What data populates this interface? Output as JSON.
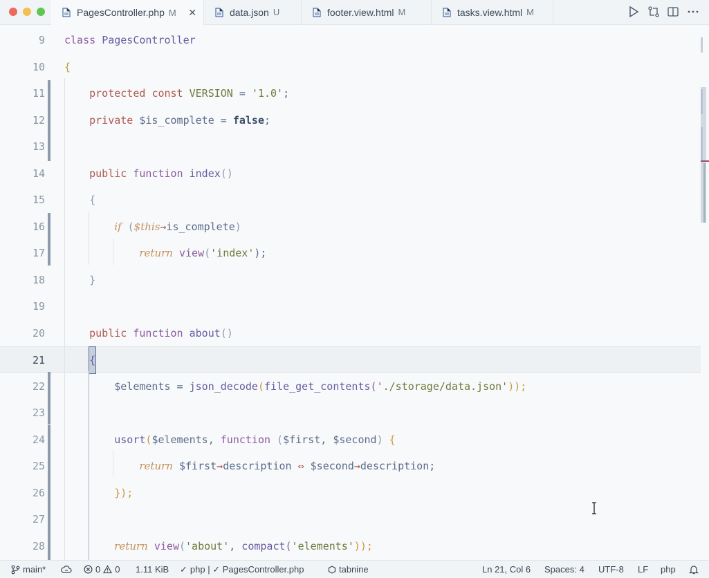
{
  "tabs": [
    {
      "name": "PagesController.php",
      "badge": "M"
    },
    {
      "name": "data.json",
      "badge": "U"
    },
    {
      "name": "footer.view.html",
      "badge": "M"
    },
    {
      "name": "tasks.view.html",
      "badge": "M"
    }
  ],
  "actions": [
    "run-icon",
    "compare-changes-icon",
    "split-editor-icon",
    "more-actions-icon"
  ],
  "editor": {
    "current_line": 21,
    "lines": [
      {
        "n": "9",
        "tokens": [
          [
            "class",
            "fn"
          ],
          [
            " ",
            ""
          ],
          [
            "PagesController",
            "nm"
          ]
        ]
      },
      {
        "n": "10",
        "tokens": [
          [
            "{",
            "pp"
          ]
        ]
      },
      {
        "n": "11",
        "tokens": [
          [
            "    ",
            ""
          ],
          [
            "protected",
            "kw"
          ],
          [
            " ",
            ""
          ],
          [
            "const",
            "kw"
          ],
          [
            " ",
            ""
          ],
          [
            "VERSION",
            "str"
          ],
          [
            " = ",
            "var"
          ],
          [
            "'1.0'",
            "str"
          ],
          [
            ";",
            "var"
          ]
        ]
      },
      {
        "n": "12",
        "tokens": [
          [
            "    ",
            ""
          ],
          [
            "private",
            "kw"
          ],
          [
            " ",
            ""
          ],
          [
            "$is_complete",
            "var"
          ],
          [
            " = ",
            "var"
          ],
          [
            "false",
            "bool"
          ],
          [
            ";",
            "var"
          ]
        ]
      },
      {
        "n": "13",
        "tokens": []
      },
      {
        "n": "14",
        "tokens": [
          [
            "    ",
            ""
          ],
          [
            "public",
            "kw"
          ],
          [
            " ",
            ""
          ],
          [
            "function",
            "fn"
          ],
          [
            " ",
            ""
          ],
          [
            "index",
            "nm"
          ],
          [
            "()",
            "pb"
          ]
        ]
      },
      {
        "n": "15",
        "tokens": [
          [
            "    ",
            ""
          ],
          [
            "{",
            "pb"
          ]
        ]
      },
      {
        "n": "16",
        "tokens": [
          [
            "        ",
            ""
          ],
          [
            "if",
            "ret"
          ],
          [
            " (",
            "pb"
          ],
          [
            "$this",
            "ret"
          ],
          [
            "→",
            "op"
          ],
          [
            "is_complete",
            "var"
          ],
          [
            ")",
            "pb"
          ]
        ]
      },
      {
        "n": "17",
        "tokens": [
          [
            "            ",
            ""
          ],
          [
            "return",
            "ret"
          ],
          [
            " ",
            ""
          ],
          [
            "view",
            "fn"
          ],
          [
            "(",
            "pb"
          ],
          [
            "'index'",
            "str"
          ],
          [
            ");",
            "var"
          ]
        ]
      },
      {
        "n": "18",
        "tokens": [
          [
            "    ",
            ""
          ],
          [
            "}",
            "pb"
          ]
        ]
      },
      {
        "n": "19",
        "tokens": []
      },
      {
        "n": "20",
        "tokens": [
          [
            "    ",
            ""
          ],
          [
            "public",
            "kw"
          ],
          [
            " ",
            ""
          ],
          [
            "function",
            "fn"
          ],
          [
            " ",
            ""
          ],
          [
            "about",
            "nm"
          ],
          [
            "()",
            "pb"
          ]
        ]
      },
      {
        "n": "21",
        "tokens": [
          [
            "    ",
            ""
          ],
          [
            "{",
            "cursor"
          ]
        ]
      },
      {
        "n": "22",
        "tokens": [
          [
            "        ",
            ""
          ],
          [
            "$elements",
            "var"
          ],
          [
            " = ",
            "var"
          ],
          [
            "json_decode",
            "nm"
          ],
          [
            "(",
            "pp"
          ],
          [
            "file_get_contents",
            "nm"
          ],
          [
            "(",
            "fn"
          ],
          [
            "'./storage/data.json'",
            "str"
          ],
          [
            "));",
            "pp"
          ]
        ]
      },
      {
        "n": "23",
        "tokens": []
      },
      {
        "n": "24",
        "tokens": [
          [
            "        ",
            ""
          ],
          [
            "usort",
            "nm"
          ],
          [
            "(",
            "pp"
          ],
          [
            "$elements",
            "var"
          ],
          [
            ", ",
            "var"
          ],
          [
            "function",
            "fn"
          ],
          [
            " (",
            "pb"
          ],
          [
            "$first",
            "var"
          ],
          [
            ", ",
            "var"
          ],
          [
            "$second",
            "var"
          ],
          [
            ") ",
            "pb"
          ],
          [
            "{",
            "pp"
          ]
        ]
      },
      {
        "n": "25",
        "tokens": [
          [
            "            ",
            ""
          ],
          [
            "return",
            "ret"
          ],
          [
            " ",
            ""
          ],
          [
            "$first",
            "var"
          ],
          [
            "→",
            "op"
          ],
          [
            "description",
            "var"
          ],
          [
            " ⇔ ",
            "op"
          ],
          [
            "$second",
            "var"
          ],
          [
            "→",
            "op"
          ],
          [
            "description",
            "var"
          ],
          [
            ";",
            "var"
          ]
        ]
      },
      {
        "n": "26",
        "tokens": [
          [
            "        ",
            ""
          ],
          [
            "});",
            "pp"
          ]
        ]
      },
      {
        "n": "27",
        "tokens": []
      },
      {
        "n": "28",
        "tokens": [
          [
            "        ",
            ""
          ],
          [
            "return",
            "ret"
          ],
          [
            " ",
            ""
          ],
          [
            "view",
            "fn"
          ],
          [
            "(",
            "pb"
          ],
          [
            "'about'",
            "str"
          ],
          [
            ", ",
            "var"
          ],
          [
            "compact",
            "nm"
          ],
          [
            "(",
            "fn"
          ],
          [
            "'elements'",
            "str"
          ],
          [
            "));",
            "pp"
          ]
        ]
      }
    ]
  },
  "status": {
    "branch": "main*",
    "sync_icon": "cloud-sync-icon",
    "errors": "0",
    "warnings": "0",
    "file_size": "1.11 KiB",
    "lint": "php | ✓ PagesController.php",
    "tabnine": "tabnine",
    "cursor_pos": "Ln 21, Col 6",
    "spaces": "Spaces: 4",
    "encoding": "UTF-8",
    "eol": "LF",
    "language": "php"
  }
}
